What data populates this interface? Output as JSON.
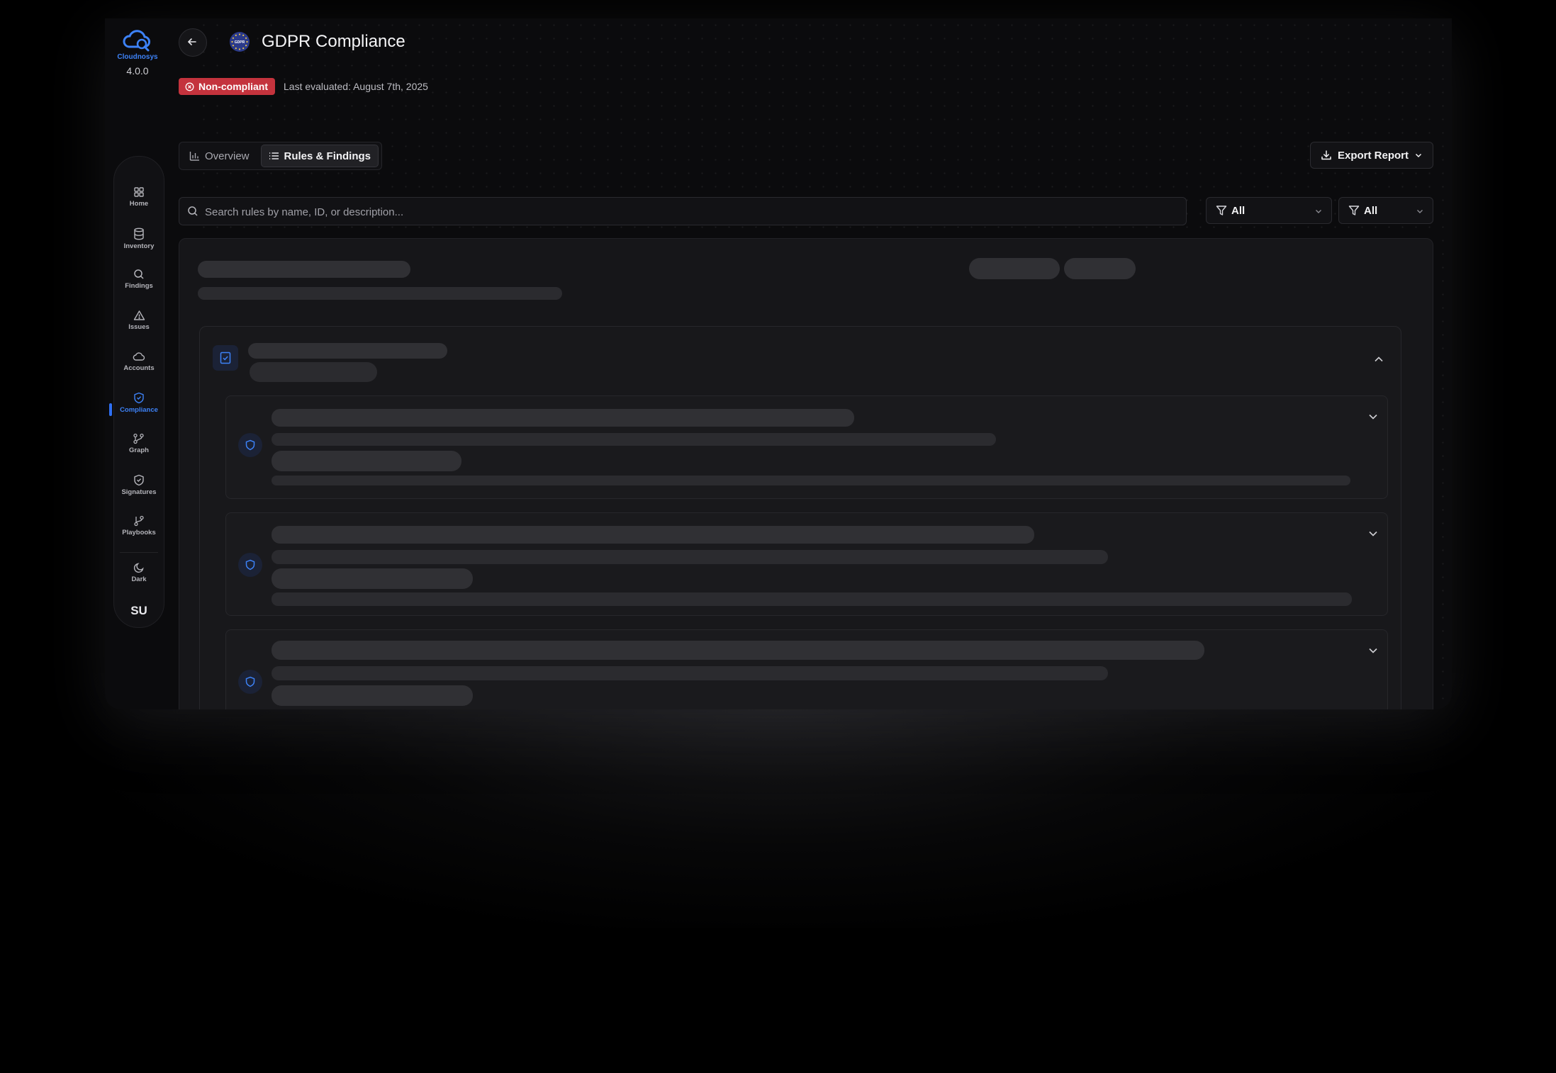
{
  "app": {
    "name": "Cloudnosys",
    "version": "4.0.0",
    "brand_color": "#3d82f7"
  },
  "sidebar": {
    "items": [
      {
        "label": "Home",
        "icon": "grid-icon"
      },
      {
        "label": "Inventory",
        "icon": "database-icon"
      },
      {
        "label": "Findings",
        "icon": "search-icon"
      },
      {
        "label": "Issues",
        "icon": "warning-icon"
      },
      {
        "label": "Accounts",
        "icon": "cloud-icon"
      },
      {
        "label": "Compliance",
        "icon": "shield-icon",
        "active": true
      },
      {
        "label": "Graph",
        "icon": "graph-icon"
      },
      {
        "label": "Signatures",
        "icon": "shield-check-icon"
      },
      {
        "label": "Playbooks",
        "icon": "branch-icon"
      }
    ],
    "theme_label": "Dark",
    "user_initials": "SU"
  },
  "header": {
    "badge_text": "GDPR",
    "title": "GDPR Compliance",
    "status": "Non-compliant",
    "status_color": "#c4333d",
    "last_evaluated": "Last evaluated: August 7th, 2025"
  },
  "tabs": [
    {
      "label": "Overview",
      "active": false
    },
    {
      "label": "Rules & Findings",
      "active": true
    }
  ],
  "toolbar": {
    "export_label": "Export Report"
  },
  "search": {
    "placeholder": "Search rules by name, ID, or description..."
  },
  "filters": [
    {
      "value": "All"
    },
    {
      "value": "All"
    }
  ],
  "content": {
    "state": "loading",
    "rule_rows_visible": 3
  }
}
